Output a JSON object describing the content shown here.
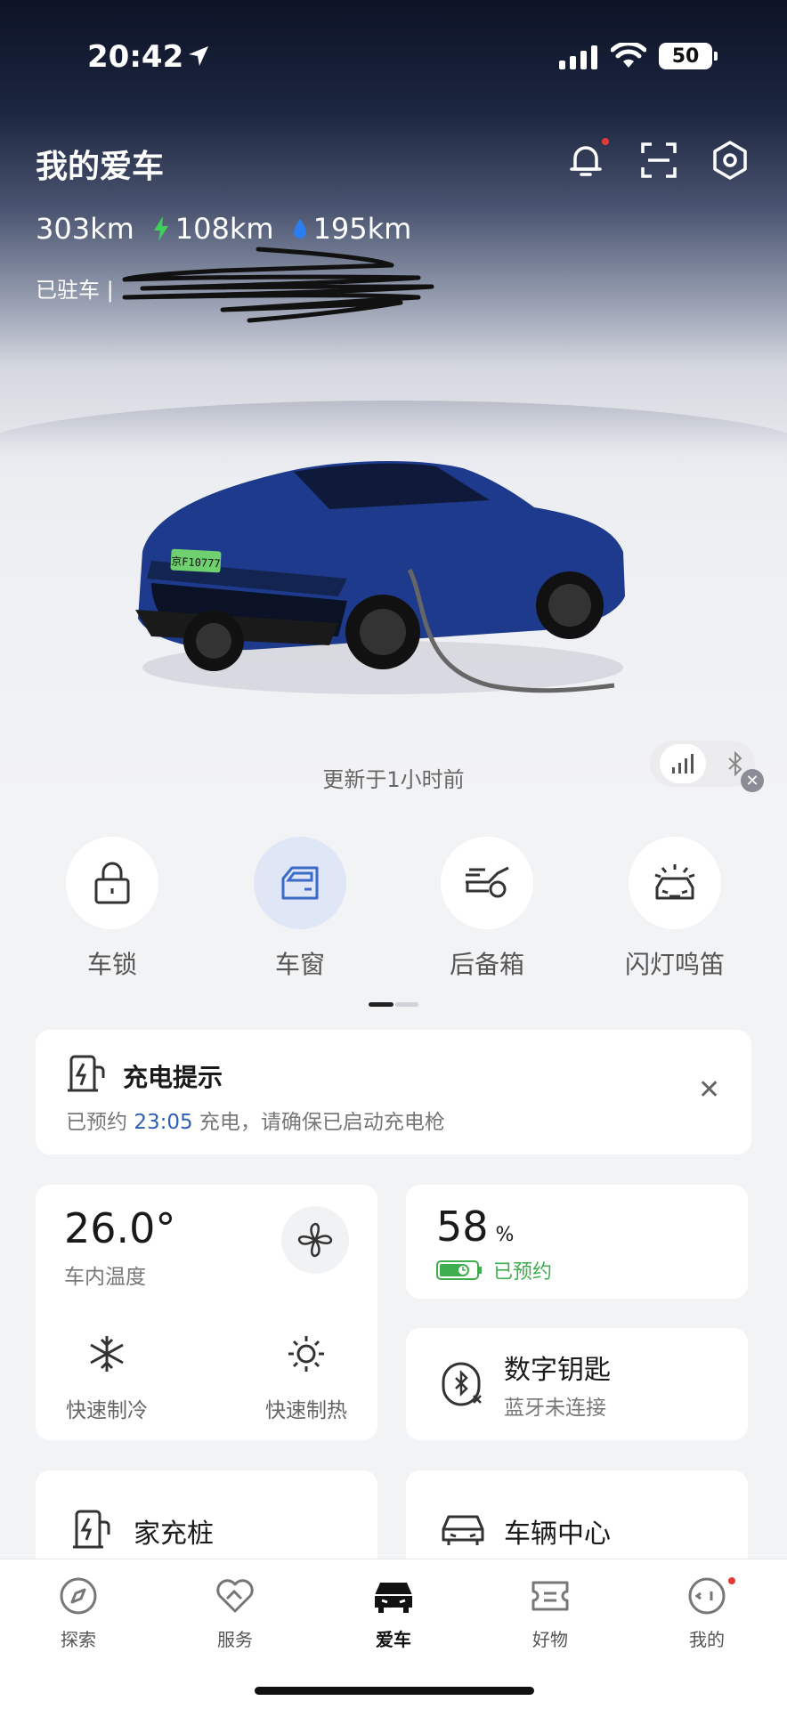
{
  "status_bar": {
    "time": "20:42",
    "battery": "50"
  },
  "header": {
    "title": "我的爱车"
  },
  "range": {
    "total": "303km",
    "electric": "108km",
    "fuel": "195km"
  },
  "parking": {
    "label": "已驻车 |"
  },
  "car": {
    "plate": "京F10777",
    "updated": "更新于1小时前"
  },
  "quick_actions": [
    {
      "label": "车锁"
    },
    {
      "label": "车窗"
    },
    {
      "label": "后备箱"
    },
    {
      "label": "闪灯鸣笛"
    }
  ],
  "charge_tip": {
    "title": "充电提示",
    "prefix": "已预约",
    "time": "23:05",
    "suffix": "充电，请确保已启动充电枪"
  },
  "climate": {
    "temperature": "26.0°",
    "temperature_label": "车内温度",
    "cool_label": "快速制冷",
    "heat_label": "快速制热"
  },
  "battery_card": {
    "percent": "58",
    "unit": "%",
    "status": "已预约"
  },
  "digital_key": {
    "title": "数字钥匙",
    "subtitle": "蓝牙未连接"
  },
  "home_charger": {
    "title": "家充桩"
  },
  "vehicle_center": {
    "title": "车辆中心"
  },
  "tabs": [
    {
      "label": "探索"
    },
    {
      "label": "服务"
    },
    {
      "label": "爱车"
    },
    {
      "label": "好物"
    },
    {
      "label": "我的"
    }
  ],
  "colors": {
    "accent_blue": "#2f5fb3",
    "charge_green": "#3fae4f",
    "notif_red": "#e53935"
  }
}
